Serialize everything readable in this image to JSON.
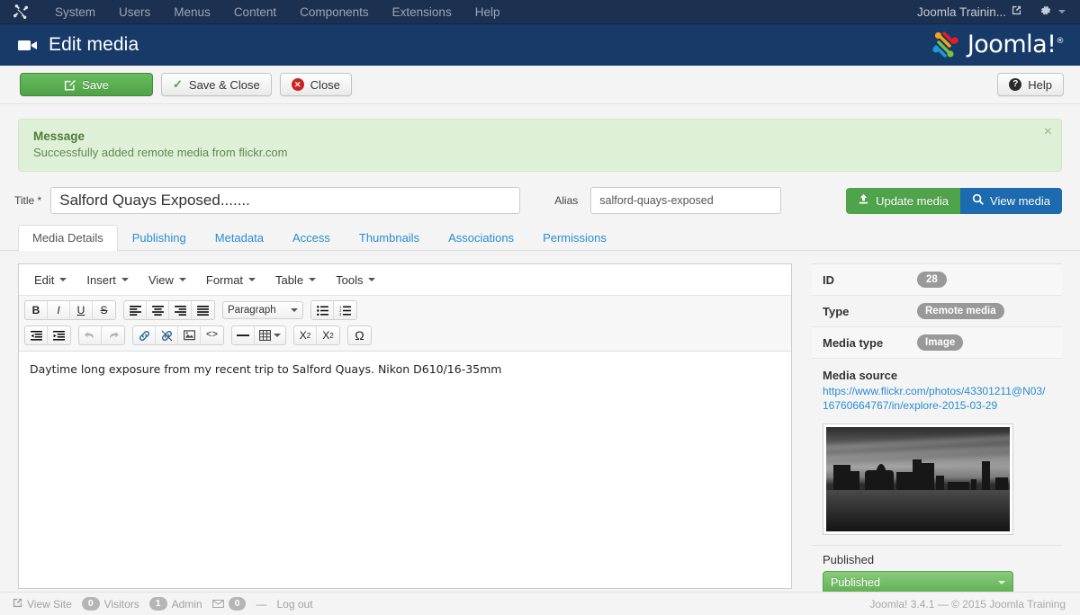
{
  "topbar": {
    "brand_icon": "joomla-mark-icon",
    "menu": [
      {
        "label": "System"
      },
      {
        "label": "Users"
      },
      {
        "label": "Menus"
      },
      {
        "label": "Content"
      },
      {
        "label": "Components"
      },
      {
        "label": "Extensions"
      },
      {
        "label": "Help"
      }
    ],
    "site_name": "Joomla Trainin...",
    "external_icon": "external-link-icon",
    "gear_icon": "gear-icon"
  },
  "header": {
    "icon": "video-camera-icon",
    "title": "Edit media",
    "logo_text": "Joomla!",
    "logo_sup": "®"
  },
  "toolbar": {
    "save_label": "Save",
    "save_close_label": "Save & Close",
    "close_label": "Close",
    "help_label": "Help"
  },
  "message": {
    "title": "Message",
    "body": "Successfully added remote media from flickr.com",
    "close_glyph": "×"
  },
  "form": {
    "title_label": "Title *",
    "title_value": "Salford Quays Exposed.......",
    "title_placeholder": "Title",
    "alias_label": "Alias",
    "alias_value": "salford-quays-exposed",
    "alias_placeholder": "Alias",
    "update_media_label": "Update media",
    "view_media_label": "View media"
  },
  "tabs": [
    {
      "label": "Media Details",
      "active": true
    },
    {
      "label": "Publishing",
      "active": false
    },
    {
      "label": "Metadata",
      "active": false
    },
    {
      "label": "Access",
      "active": false
    },
    {
      "label": "Thumbnails",
      "active": false
    },
    {
      "label": "Associations",
      "active": false
    },
    {
      "label": "Permissions",
      "active": false
    }
  ],
  "editor": {
    "menus": [
      {
        "label": "Edit"
      },
      {
        "label": "Insert"
      },
      {
        "label": "View"
      },
      {
        "label": "Format"
      },
      {
        "label": "Table"
      },
      {
        "label": "Tools"
      }
    ],
    "format_select_value": "Paragraph",
    "toolbar_row1": [
      {
        "name": "bold-icon",
        "glyph": "B"
      },
      {
        "name": "italic-icon",
        "glyph": "I"
      },
      {
        "name": "underline-icon",
        "glyph": "U"
      },
      {
        "name": "strikethrough-icon",
        "glyph": "S"
      },
      {
        "name": "align-left-icon",
        "glyph": "≡"
      },
      {
        "name": "align-center-icon",
        "glyph": "≡"
      },
      {
        "name": "align-right-icon",
        "glyph": "≡"
      },
      {
        "name": "align-justify-icon",
        "glyph": "≡"
      },
      {
        "name": "bullet-list-icon",
        "glyph": "☰"
      },
      {
        "name": "numbered-list-icon",
        "glyph": "☰"
      }
    ],
    "toolbar_row2": [
      {
        "name": "outdent-icon",
        "glyph": "⇤"
      },
      {
        "name": "indent-icon",
        "glyph": "⇥"
      },
      {
        "name": "undo-icon",
        "glyph": "↶"
      },
      {
        "name": "redo-icon",
        "glyph": "↷"
      },
      {
        "name": "link-icon",
        "glyph": "⚭"
      },
      {
        "name": "unlink-icon",
        "glyph": "⚭"
      },
      {
        "name": "image-icon",
        "glyph": "▣"
      },
      {
        "name": "source-code-icon",
        "glyph": "<>"
      },
      {
        "name": "horizontal-rule-icon",
        "glyph": "—"
      },
      {
        "name": "table-icon",
        "glyph": "▦"
      },
      {
        "name": "subscript-icon",
        "glyph": "X₂"
      },
      {
        "name": "superscript-icon",
        "glyph": "X²"
      },
      {
        "name": "special-character-icon",
        "glyph": "Ω"
      }
    ],
    "content": "Daytime long exposure from my recent trip to Salford Quays. Nikon D610/16-35mm"
  },
  "sidebar": {
    "rows": [
      {
        "key": "ID",
        "value": "28"
      },
      {
        "key": "Type",
        "value": "Remote media"
      },
      {
        "key": "Media type",
        "value": "Image"
      }
    ],
    "media_source_label": "Media source",
    "media_source_url": "https://www.flickr.com/photos/43301211@N03/16760664767/in/explore-2015-03-29",
    "thumbnail_alt": "Salford Quays black and white long exposure",
    "published_label": "Published",
    "published_value": "Published"
  },
  "footer": {
    "view_site_label": "View Site",
    "view_site_icon": "external-link-icon",
    "visitors_count": "0",
    "visitors_label": "Visitors",
    "admin_count": "1",
    "admin_label": "Admin",
    "mail_icon": "envelope-icon",
    "mail_count": "0",
    "separator": "—",
    "logout_label": "Log out",
    "copyright": "Joomla! 3.4.1 — © 2015 Joomla Training"
  },
  "colors": {
    "topbar": "#1c3050",
    "header": "#173a68",
    "green": "#4ea247",
    "blue": "#1c6bb0",
    "link": "#2a8cd4",
    "alert_bg": "#dff0d8"
  }
}
